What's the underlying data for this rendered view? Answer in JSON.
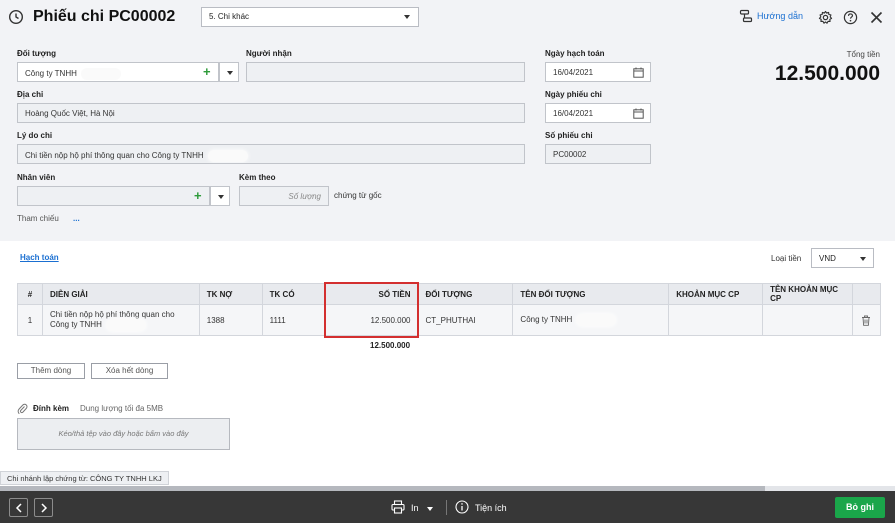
{
  "header": {
    "title": "Phiếu chi PC00002",
    "voucher_type": "5. Chi khác",
    "guide_label": "Hướng dẫn"
  },
  "form": {
    "subject": {
      "label": "Đối tượng",
      "value": "Công ty TNHH"
    },
    "recipient": {
      "label": "Người nhận",
      "value": ""
    },
    "address": {
      "label": "Địa chỉ",
      "value": "Hoàng Quốc Việt, Hà Nội"
    },
    "reason": {
      "label": "Lý do chi",
      "value": "Chi tiền nộp hộ phí thông quan cho Công ty TNHH"
    },
    "employee": {
      "label": "Nhân viên",
      "value": ""
    },
    "attached": {
      "label": "Kèm theo",
      "placeholder": "Số lượng",
      "suffix": "chứng từ gốc"
    },
    "reference": {
      "label": "Tham chiếu",
      "link": "..."
    },
    "accounting_date": {
      "label": "Ngày hạch toán",
      "value": "16/04/2021"
    },
    "voucher_date": {
      "label": "Ngày phiếu chi",
      "value": "16/04/2021"
    },
    "voucher_no": {
      "label": "Số phiếu chi",
      "value": "PC00002"
    }
  },
  "total": {
    "label": "Tổng tiền",
    "value": "12.500.000"
  },
  "accounting": {
    "tab_label": "Hạch toán",
    "currency_label": "Loại tiền",
    "currency": "VND",
    "columns": [
      "#",
      "DIỄN GIẢI",
      "TK NỢ",
      "TK CÓ",
      "SỐ TIỀN",
      "ĐỐI TƯỢNG",
      "TÊN ĐỐI TƯỢNG",
      "KHOẢN MỤC CP",
      "TÊN KHOẢN MỤC CP"
    ],
    "rows": [
      {
        "index": "1",
        "description": "Chi tiền nộp hộ phí thông quan cho Công ty TNHH",
        "debit": "1388",
        "credit": "1111",
        "amount": "12.500.000",
        "object": "CT_PHUTHAI",
        "object_name": "Công ty TNHH",
        "cost_item": "",
        "cost_item_name": ""
      }
    ],
    "sum_amount": "12.500.000",
    "add_row": "Thêm dòng",
    "clear_rows": "Xóa hết dòng"
  },
  "attachment": {
    "label": "Đính kèm",
    "hint": "Dung lượng tối đa 5MB",
    "dropzone": "Kéo/thả tệp vào đây hoặc bấm vào đây"
  },
  "branch": "Chi nhánh lập chứng từ: CÔNG TY TNHH LKJ",
  "footer": {
    "print": "In",
    "utilities": "Tiện ích",
    "save": "Bỏ ghi"
  }
}
